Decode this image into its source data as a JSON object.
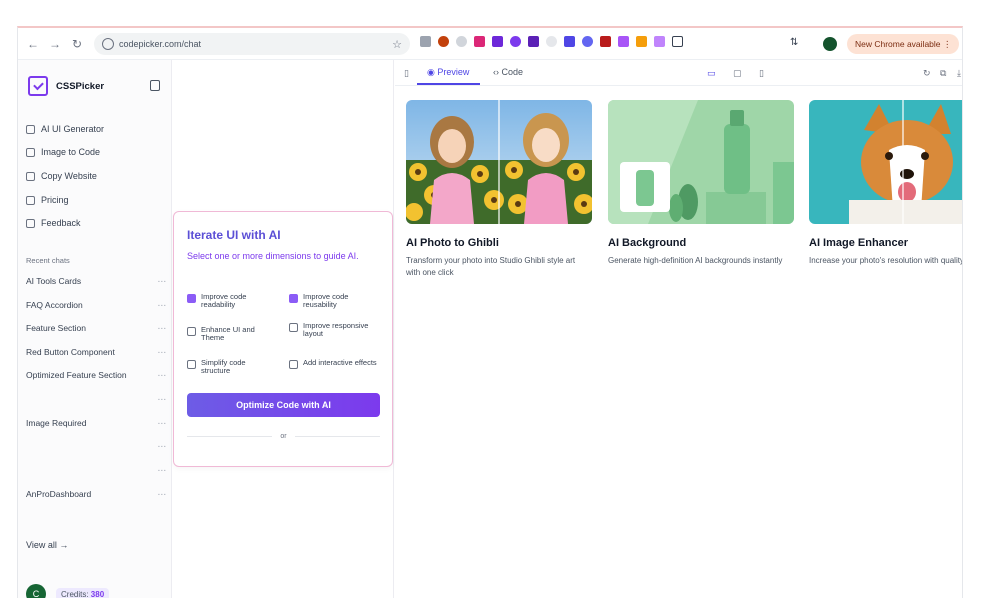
{
  "browser": {
    "url": "codepicker.com/chat",
    "update_label": "New Chrome available"
  },
  "sidebar": {
    "brand": "CSSPicker",
    "nav": [
      {
        "label": "AI UI Generator",
        "icon": "layout-icon"
      },
      {
        "label": "Image to Code",
        "icon": "image-icon"
      },
      {
        "label": "Copy Website",
        "icon": "copy-icon"
      },
      {
        "label": "Pricing",
        "icon": "card-icon"
      },
      {
        "label": "Feedback",
        "icon": "message-icon"
      }
    ],
    "recent_label": "Recent chats",
    "recent": [
      {
        "label": "AI Tools Cards"
      },
      {
        "label": "FAQ Accordion"
      },
      {
        "label": "Feature Section"
      },
      {
        "label": "Red Button Component"
      },
      {
        "label": "Optimized Feature Section"
      },
      {
        "label": ""
      },
      {
        "label": "Image Required"
      },
      {
        "label": ""
      },
      {
        "label": ""
      },
      {
        "label": "AnProDashboard"
      }
    ],
    "view_all": "View all →",
    "avatar_initial": "C",
    "credits_label": "Credits:",
    "credits_value": "380"
  },
  "iterate": {
    "title": "Iterate UI with AI",
    "subtitle": "Select one or more dimensions to guide AI.",
    "options": [
      {
        "label": "Improve code readability",
        "checked": true
      },
      {
        "label": "Improve code reusability",
        "checked": true
      },
      {
        "label": "Enhance UI and Theme",
        "checked": false
      },
      {
        "label": "Improve responsive layout",
        "checked": false
      },
      {
        "label": "Simplify code structure",
        "checked": false
      },
      {
        "label": "Add interactive effects",
        "checked": false
      }
    ],
    "button": "Optimize Code with AI",
    "or": "or"
  },
  "preview": {
    "tab_preview": "Preview",
    "tab_code": "Code",
    "tools": [
      {
        "title": "AI Photo to Ghibli",
        "desc": "Transform your photo into Studio Ghibli style art with one click"
      },
      {
        "title": "AI Background",
        "desc": "Generate high-definition AI backgrounds instantly"
      },
      {
        "title": "AI Image Enhancer",
        "desc": "Increase your photo's resolution with quality loss"
      }
    ]
  },
  "colors": {
    "accent": "#7c3aed",
    "button": "#6d5ce6",
    "card_border": "#f0b9d6"
  }
}
